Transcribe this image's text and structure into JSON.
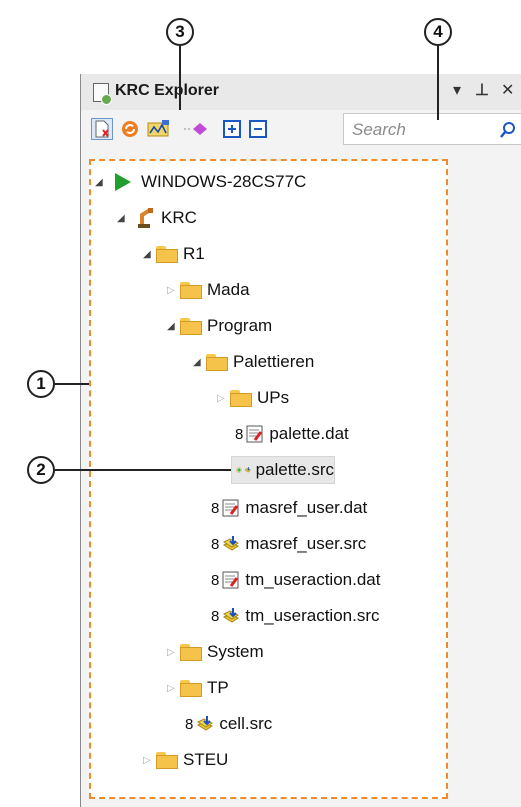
{
  "callouts": [
    "3",
    "4",
    "1",
    "2"
  ],
  "window": {
    "title": "KRC Explorer",
    "pin_glyph": "⊥",
    "close_glyph": "✕",
    "menu_glyph": "▾"
  },
  "toolbar": {
    "search_placeholder": "Search",
    "buttons": [
      "new-file-icon",
      "refresh-icon",
      "io-config-icon",
      "pink-diamond-icon",
      "expand-all-icon",
      "collapse-all-icon"
    ]
  },
  "tree": {
    "root": "WINDOWS-28CS77C",
    "krc": "KRC",
    "r1": "R1",
    "mada": "Mada",
    "program": "Program",
    "palettieren": "Palettieren",
    "ups": "UPs",
    "palette_dat": "palette.dat",
    "palette_src": "palette.src",
    "masref_user_dat": "masref_user.dat",
    "masref_user_src": "masref_user.src",
    "tm_useraction_dat": "tm_useraction.dat",
    "tm_useraction_src": "tm_useraction.src",
    "system": "System",
    "tp": "TP",
    "cell_src": "cell.src",
    "steu": "STEU",
    "lock_marker": "8"
  },
  "colors": {
    "selection_outline": "#f08a2c",
    "active_marker": "#2cc52c"
  }
}
